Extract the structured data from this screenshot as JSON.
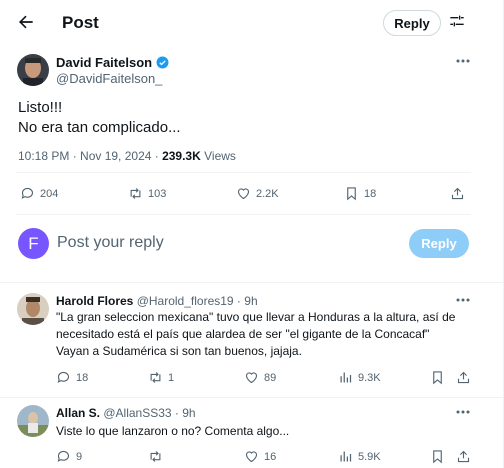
{
  "header": {
    "title": "Post",
    "reply_label": "Reply"
  },
  "post": {
    "author_name": "David Faitelson",
    "author_handle": "@DavidFaitelson_",
    "text_line1": "Listo!!!",
    "text_line2": "No era tan complicado...",
    "time": "10:18 PM · Nov 19, 2024 · ",
    "views_count": "239.3K",
    "views_label": " Views",
    "actions": {
      "replies": "204",
      "reposts": "103",
      "likes": "2.2K",
      "bookmarks": "18"
    }
  },
  "composer": {
    "avatar_letter": "F",
    "placeholder": "Post your reply",
    "button_label": "Reply"
  },
  "replies": [
    {
      "name": "Harold Flores",
      "handle_time": "@Harold_flores19 · 9h",
      "lines": [
        "\"La gran seleccion mexicana\" tuvo que llevar a Honduras a la altura, así de",
        "necesitado está el país que alardea de ser \"el gigante de la Concacaf\"",
        "Vayan a Sudamérica si son tan buenos, jajaja."
      ],
      "actions": {
        "replies": "18",
        "reposts": "1",
        "likes": "89",
        "views": "9.3K"
      }
    },
    {
      "name": "Allan S.",
      "handle_time": "@AllanSS33 · 9h",
      "lines": [
        "Viste lo que lanzaron o no? Comenta algo..."
      ],
      "actions": {
        "replies": "9",
        "reposts": "",
        "likes": "16",
        "views": "5.9K"
      }
    }
  ],
  "colors": {
    "accent": "#1d9bf0",
    "reply_disabled": "#8ecdf8",
    "avatar_f": "#7856ff"
  }
}
